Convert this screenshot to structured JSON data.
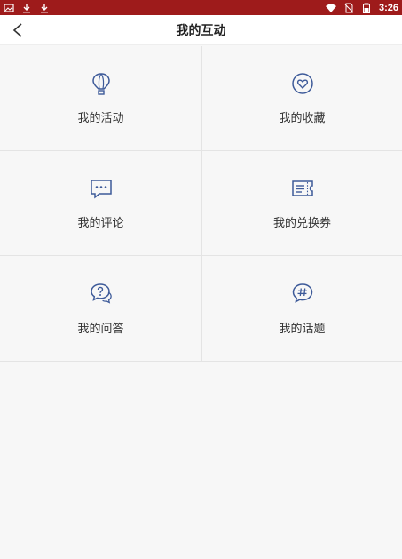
{
  "status_bar": {
    "time": "3:26",
    "icons": [
      "image-icon",
      "download-icon",
      "download-icon",
      "wifi-icon",
      "no-sim-icon",
      "battery-icon"
    ]
  },
  "header": {
    "title": "我的互动",
    "back_icon": "chevron-left-icon"
  },
  "menu": {
    "items": [
      {
        "label": "我的活动",
        "icon": "hot-air-balloon-icon"
      },
      {
        "label": "我的收藏",
        "icon": "heart-circle-icon"
      },
      {
        "label": "我的评论",
        "icon": "comment-dots-icon"
      },
      {
        "label": "我的兑换券",
        "icon": "coupon-icon"
      },
      {
        "label": "我的问答",
        "icon": "question-bubble-icon"
      },
      {
        "label": "我的话题",
        "icon": "hashtag-bubble-icon"
      }
    ]
  },
  "colors": {
    "status_bar": "#9e1b1b",
    "icon_blue": "#3d5a99",
    "background": "#f7f7f7",
    "header": "#ffffff"
  }
}
